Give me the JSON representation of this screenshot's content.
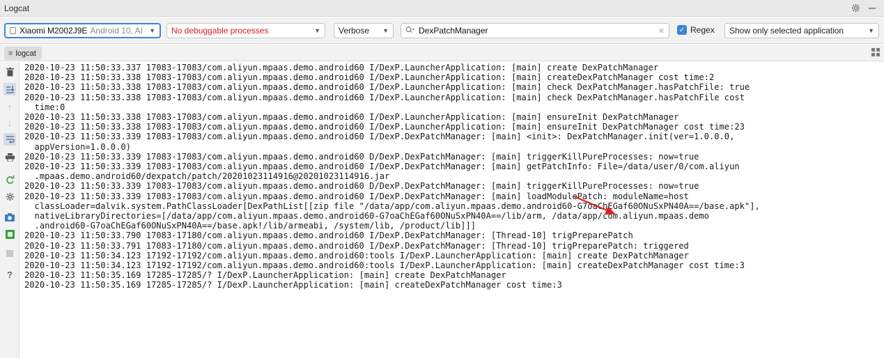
{
  "window": {
    "title": "Logcat"
  },
  "toolbar": {
    "device_name": "Xiaomi M2002J9E",
    "device_detail": "Android 10, AI",
    "process": "No debuggable processes",
    "level": "Verbose",
    "search_value": "DexPatchManager",
    "regex_label": "Regex",
    "filter": "Show only selected application"
  },
  "tab": {
    "label": "logcat"
  },
  "colors": {
    "accent": "#3d85d6",
    "error_text": "#d21e1e",
    "arrow": "#e0201e"
  },
  "icons": {
    "sidebar": [
      "trash-icon",
      "scroll-to-end-icon",
      "up-icon",
      "down-icon",
      "soft-wrap-icon",
      "print-icon",
      "restart-icon",
      "settings-icon",
      "screenshot-icon",
      "screen-record-icon",
      "stop-icon",
      "help-icon"
    ]
  },
  "log_lines": [
    "2020-10-23 11:50:33.337 17083-17083/com.aliyun.mpaas.demo.android60 I/DexP.LauncherApplication: [main] create DexPatchManager",
    "2020-10-23 11:50:33.338 17083-17083/com.aliyun.mpaas.demo.android60 I/DexP.LauncherApplication: [main] createDexPatchManager cost time:2",
    "2020-10-23 11:50:33.338 17083-17083/com.aliyun.mpaas.demo.android60 I/DexP.LauncherApplication: [main] check DexPatchManager.hasPatchFile: true",
    "2020-10-23 11:50:33.338 17083-17083/com.aliyun.mpaas.demo.android60 I/DexP.LauncherApplication: [main] check DexPatchManager.hasPatchFile cost",
    "  time:0",
    "2020-10-23 11:50:33.338 17083-17083/com.aliyun.mpaas.demo.android60 I/DexP.LauncherApplication: [main] ensureInit DexPatchManager",
    "2020-10-23 11:50:33.338 17083-17083/com.aliyun.mpaas.demo.android60 I/DexP.LauncherApplication: [main] ensureInit DexPatchManager cost time:23",
    "2020-10-23 11:50:33.339 17083-17083/com.aliyun.mpaas.demo.android60 I/DexP.DexPatchManager: [main] <init>: DexPatchManager.init(ver=1.0.0.0,",
    "  appVersion=1.0.0.0)",
    "2020-10-23 11:50:33.339 17083-17083/com.aliyun.mpaas.demo.android60 D/DexP.DexPatchManager: [main] triggerKillPureProcesses: now=true",
    "2020-10-23 11:50:33.339 17083-17083/com.aliyun.mpaas.demo.android60 I/DexP.DexPatchManager: [main] getPatchInfo: File=/data/user/0/com.aliyun",
    "  .mpaas.demo.android60/dexpatch/patch/20201023114916@20201023114916.jar",
    "2020-10-23 11:50:33.339 17083-17083/com.aliyun.mpaas.demo.android60 D/DexP.DexPatchManager: [main] triggerKillPureProcesses: now=true",
    "2020-10-23 11:50:33.339 17083-17083/com.aliyun.mpaas.demo.android60 I/DexP.DexPatchManager: [main] loadModulePatch: moduleName=host",
    "  classLoader=dalvik.system.PathClassLoader[DexPathList[[zip file \"/data/app/com.aliyun.mpaas.demo.android60-G7oaChEGaf60ONuSxPN40A==/base.apk\"],",
    "  nativeLibraryDirectories=[/data/app/com.aliyun.mpaas.demo.android60-G7oaChEGaf60ONuSxPN40A==/lib/arm, /data/app/com.aliyun.mpaas.demo",
    "  .android60-G7oaChEGaf60ONuSxPN40A==/base.apk!/lib/armeabi, /system/lib, /product/lib]]]",
    "2020-10-23 11:50:33.790 17083-17180/com.aliyun.mpaas.demo.android60 I/DexP.DexPatchManager: [Thread-10] trigPreparePatch",
    "2020-10-23 11:50:33.791 17083-17180/com.aliyun.mpaas.demo.android60 I/DexP.DexPatchManager: [Thread-10] trigPreparePatch: triggered",
    "2020-10-23 11:50:34.123 17192-17192/com.aliyun.mpaas.demo.android60:tools I/DexP.LauncherApplication: [main] create DexPatchManager",
    "2020-10-23 11:50:34.123 17192-17192/com.aliyun.mpaas.demo.android60:tools I/DexP.LauncherApplication: [main] createDexPatchManager cost time:3",
    "2020-10-23 11:50:35.169 17285-17285/? I/DexP.LauncherApplication: [main] create DexPatchManager",
    "2020-10-23 11:50:35.169 17285-17285/? I/DexP.LauncherApplication: [main] createDexPatchManager cost time:3"
  ]
}
